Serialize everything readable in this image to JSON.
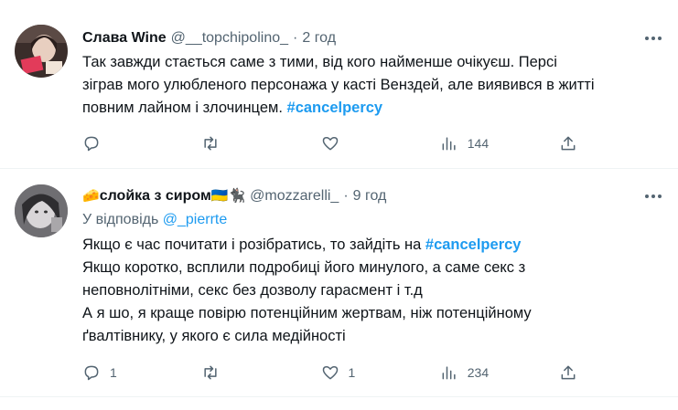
{
  "tweets": [
    {
      "name": "Слава Wine",
      "handle": "@__topchipolino_",
      "dot": "·",
      "time": "2 год",
      "lines": [
        "Так завжди стається саме з тими, від кого найменше очікуєш. Персі",
        "зіграв мого улюбленого персонажа у касті Венздей, але виявився в житті",
        "повним лайном і злочинцем."
      ],
      "hashtag": "#cancelpercy",
      "replies": "",
      "retweets": "",
      "likes": "",
      "views": "144"
    },
    {
      "name_emoji_start": "🧀",
      "name": "слойка з сиром",
      "name_emoji_end": "🇺🇦🐈‍⬛",
      "handle": "@mozzarelli_",
      "dot": "·",
      "time": "9 год",
      "reply_prefix": "У відповідь",
      "reply_handle": "@_pierrte",
      "line1": "Якщо є час почитати і розібратись, то зайдіть на",
      "hashtag": "#cancelpercy",
      "lines": [
        "Якщо коротко, всплили подробиці його минулого, а саме секс з",
        "неповнолітніми, секс без дозволу гарасмент і т.д",
        "А я шо, я краще повірю потенційним жертвам, ніж потенційному",
        "ґвалтівнику, у якого є сила медійності"
      ],
      "replies": "1",
      "retweets": "",
      "likes": "1",
      "views": "234"
    }
  ],
  "icons": [
    "reply-icon",
    "retweet-icon",
    "like-icon",
    "views-icon",
    "share-icon",
    "more-icon"
  ],
  "colors": {
    "link": "#1d9bf0",
    "secondary": "#536471",
    "text": "#0f1419",
    "divider": "#eff3f4"
  }
}
